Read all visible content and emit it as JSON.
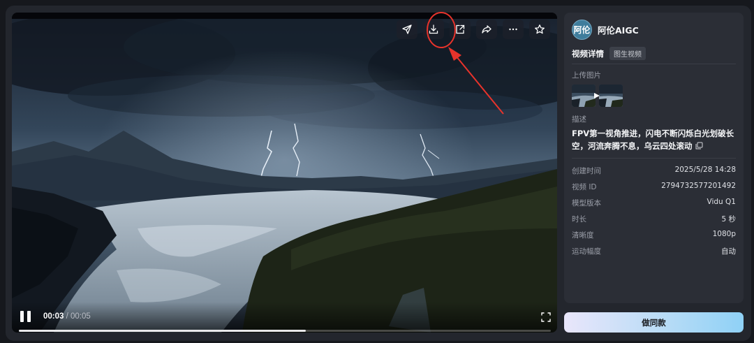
{
  "video": {
    "toolbar": [
      {
        "name": "send-icon",
        "label": "send"
      },
      {
        "name": "download-icon",
        "label": "download"
      },
      {
        "name": "export-icon",
        "label": "export"
      },
      {
        "name": "share-icon",
        "label": "share"
      },
      {
        "name": "more-icon",
        "label": "more"
      },
      {
        "name": "star-icon",
        "label": "favorite"
      }
    ],
    "current_time": "00:03",
    "separator": " / ",
    "total_time": "00:05",
    "progress": 0.54,
    "annotation_color": "#e8332b"
  },
  "panel": {
    "avatar_text": "阿伦",
    "author": "阿伦AIGC",
    "detail_title": "视频详情",
    "tag": "图生视频",
    "upload_label": "上传图片",
    "desc_label": "描述",
    "description": "FPV第一视角推进，闪电不断闪烁白光划破长空，河流奔腾不息，乌云四处滚动",
    "meta": [
      {
        "k": "创建时间",
        "v": "2025/5/28 14:28"
      },
      {
        "k": "视频 ID",
        "v": "2794732577201492"
      },
      {
        "k": "模型版本",
        "v": "Vidu Q1"
      },
      {
        "k": "时长",
        "v": "5 秒"
      },
      {
        "k": "清晰度",
        "v": "1080p"
      },
      {
        "k": "运动幅度",
        "v": "自动"
      }
    ]
  },
  "cta": {
    "label": "做同款"
  },
  "colors": {
    "panel_bg": "#2b2e36",
    "cta_gradient_end": "#8fd1f6"
  }
}
